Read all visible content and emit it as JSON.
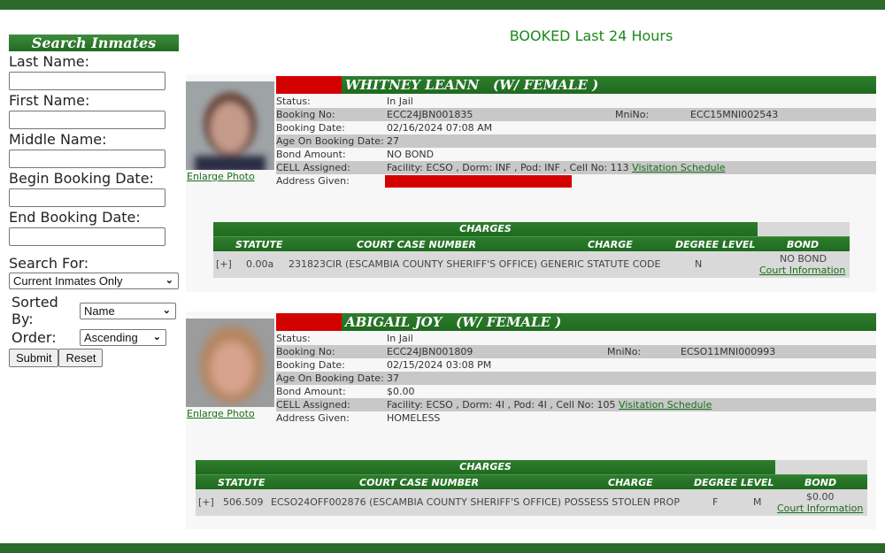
{
  "sidebar": {
    "title": "Search Inmates",
    "fields": [
      {
        "label": "Last Name:",
        "value": ""
      },
      {
        "label": "First Name:",
        "value": ""
      },
      {
        "label": "Middle Name:",
        "value": ""
      },
      {
        "label": "Begin Booking Date:",
        "value": ""
      },
      {
        "label": "End Booking Date:",
        "value": ""
      }
    ],
    "search_for_label": "Search For:",
    "search_for_value": "Current Inmates Only",
    "sorted_by_label": "Sorted By:",
    "sorted_by_value": "Name",
    "order_label": "Order:",
    "order_value": "Ascending",
    "submit_label": "Submit",
    "reset_label": "Reset"
  },
  "heading": "BOOKED Last 24 Hours",
  "inmates": [
    {
      "name": "WHITNEY LEANN   (W/ FEMALE )",
      "enlarge_label": "Enlarge Photo",
      "status_label": "Status:",
      "status": "In Jail",
      "booking_no_label": "Booking No:",
      "booking_no": "ECC24JBN001835",
      "mni_label": "MniNo:",
      "mni": "ECC15MNI002543",
      "booking_date_label": "Booking Date:",
      "booking_date": "02/16/2024 07:08 AM",
      "age_label": "Age On Booking Date:",
      "age": "27",
      "bond_label": "Bond Amount:",
      "bond": "NO BOND",
      "cell_label": "CELL Assigned:",
      "cell": "Facility: ECSO , Dorm: INF , Pod: INF , Cell No: 113",
      "visitation_label": "Visitation Schedule",
      "address_label": "Address Given:",
      "address": "",
      "charges": {
        "title": "CHARGES",
        "headers": [
          "STATUTE",
          "COURT CASE NUMBER",
          "CHARGE",
          "DEGREE LEVEL",
          "BOND"
        ],
        "rows": [
          {
            "expand": "[+]",
            "statute": "0.00a",
            "case_charge": "231823CIR (ESCAMBIA COUNTY SHERIFF'S OFFICE) GENERIC STATUTE CODE",
            "degree": "N",
            "level": "",
            "bond": "NO BOND",
            "court_link": "Court Information"
          }
        ]
      }
    },
    {
      "name": "ABIGAIL JOY   (W/ FEMALE )",
      "enlarge_label": "Enlarge Photo",
      "status_label": "Status:",
      "status": "In Jail",
      "booking_no_label": "Booking No:",
      "booking_no": "ECC24JBN001809",
      "mni_label": "MniNo:",
      "mni": "ECSO11MNI000993",
      "booking_date_label": "Booking Date:",
      "booking_date": "02/15/2024 03:08 PM",
      "age_label": "Age On Booking Date:",
      "age": "37",
      "bond_label": "Bond Amount:",
      "bond": "$0.00",
      "cell_label": "CELL Assigned:",
      "cell": "Facility: ECSO , Dorm: 4I , Pod: 4I , Cell No: 105",
      "visitation_label": "Visitation Schedule",
      "address_label": "Address Given:",
      "address": "HOMELESS",
      "charges": {
        "title": "CHARGES",
        "headers": [
          "STATUTE",
          "COURT CASE NUMBER",
          "CHARGE",
          "DEGREE LEVEL",
          "BOND"
        ],
        "rows": [
          {
            "expand": "[+]",
            "statute": "506.509",
            "case_charge": "ECSO24OFF002876 (ESCAMBIA COUNTY SHERIFF'S OFFICE) POSSESS STOLEN PROP",
            "degree": "F",
            "level": "M",
            "bond": "$0.00",
            "court_link": "Court Information"
          }
        ]
      }
    }
  ]
}
